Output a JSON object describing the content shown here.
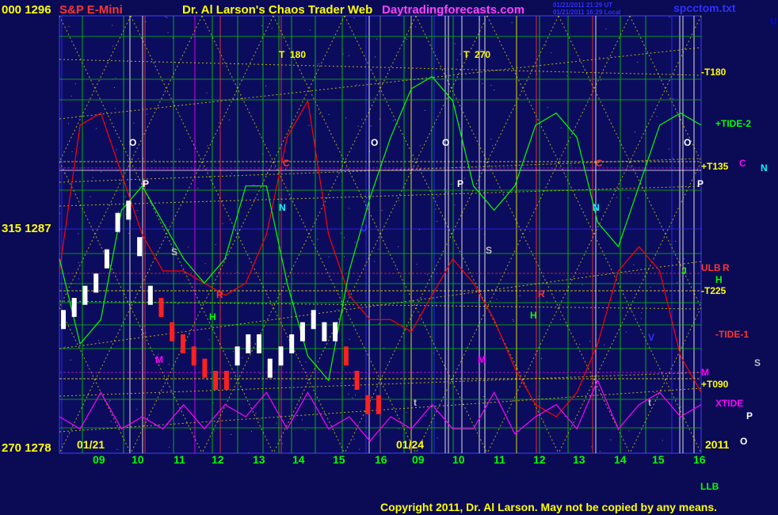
{
  "header": {
    "left_price": "000  1296",
    "instrument": "S&P E-Mini",
    "title": "Dr. Al Larson's Chaos Trader Web",
    "site": "Daytradingforecasts.com",
    "stamp1": "01/21/2011 21:29 UT",
    "stamp2": "01/21/2011 16:29 Local",
    "file": "spcctom.txt"
  },
  "price_labels": [
    {
      "label": "000  1296",
      "value": 1296
    },
    {
      "label": "315  1287",
      "value": 1287
    },
    {
      "label": "270  1278",
      "value": 1278
    }
  ],
  "chart_data": {
    "type": "line",
    "title": "S&P E-Mini",
    "ylim": [
      1278,
      1296
    ],
    "x_ticks": [
      "09",
      "10",
      "11",
      "12",
      "13",
      "14",
      "15",
      "16",
      "09",
      "10",
      "11",
      "12",
      "13",
      "14",
      "15",
      "16"
    ],
    "date_labels": [
      "01/21",
      "01/24",
      "2011"
    ],
    "top_markers": [
      "T  180",
      "T  270"
    ],
    "right_labels": [
      {
        "text": "-T180",
        "color": "#ffff00"
      },
      {
        "text": "+TIDE-2",
        "color": "#00ff00"
      },
      {
        "text": "+T135",
        "color": "#ffff00"
      },
      {
        "text": "C",
        "color": "#ff00ff"
      },
      {
        "text": "N",
        "color": "#00ffff"
      },
      {
        "text": "ULB",
        "color": "#ff3333"
      },
      {
        "text": "R",
        "color": "#ff3333"
      },
      {
        "text": "H",
        "color": "#00ff00"
      },
      {
        "text": "-T225",
        "color": "#ffff00"
      },
      {
        "text": "-TIDE-1",
        "color": "#ff3333"
      },
      {
        "text": "S",
        "color": "#c0c0c0"
      },
      {
        "text": "M",
        "color": "#ff00ff"
      },
      {
        "text": "+T090",
        "color": "#ffff00"
      },
      {
        "text": "XTIDE",
        "color": "#ff00ff"
      },
      {
        "text": "P",
        "color": "#ffffff"
      },
      {
        "text": "O",
        "color": "#ffffff"
      },
      {
        "text": "LLB",
        "color": "#00ff00"
      },
      {
        "text": "U",
        "color": "#0000ff"
      }
    ],
    "planet_markers": [
      "O",
      "P",
      "S",
      "M",
      "H",
      "R",
      "N",
      "C",
      "U",
      "V",
      "J",
      "t"
    ],
    "series": [
      {
        "color": "#ff0000",
        "values": [
          1285.5,
          1291.5,
          1292.0,
          1289.5,
          1287.0,
          1285.5,
          1285.5,
          1285.0,
          1284.5,
          1285.0,
          1287.0,
          1291.0,
          1292.5,
          1287.0,
          1284.5,
          1283.5,
          1283.5,
          1283.0,
          1284.5,
          1286.0,
          1285.0,
          1283.5,
          1281.5,
          1280.0,
          1279.5,
          1280.5,
          1282.5,
          1285.5,
          1286.5,
          1285.5,
          1282.0,
          1280.5
        ]
      },
      {
        "color": "#00ff00",
        "values": [
          1286.0,
          1282.5,
          1283.5,
          1288.0,
          1289.0,
          1287.5,
          1286.0,
          1285.0,
          1286.0,
          1289.0,
          1289.0,
          1285.0,
          1282.0,
          1281.0,
          1285.5,
          1288.5,
          1291.0,
          1293.0,
          1293.5,
          1292.5,
          1289.0,
          1288.0,
          1289.0,
          1291.5,
          1292.0,
          1291.0,
          1287.5,
          1286.5,
          1289.0,
          1291.5,
          1292.0,
          1291.5
        ]
      },
      {
        "color": "#ff00ff",
        "values": [
          1279.5,
          1279.0,
          1280.5,
          1279.0,
          1279.5,
          1279.0,
          1280.0,
          1279.0,
          1280.0,
          1279.5,
          1280.5,
          1279.0,
          1280.5,
          1279.0,
          1279.5,
          1278.5,
          1279.5,
          1279.0,
          1280.0,
          1279.0,
          1279.0,
          1280.5,
          1278.8,
          1279.5,
          1280.0,
          1279.0,
          1281.0,
          1279.0,
          1280.0,
          1280.5,
          1279.5,
          1280.0
        ]
      }
    ],
    "price_bars": [
      1283.5,
      1284.0,
      1284.5,
      1285.0,
      1286.0,
      1287.5,
      1288.0,
      1286.5,
      1284.5,
      1284.0,
      1283.0,
      1282.5,
      1282.0,
      1281.5,
      1281.0,
      1281.0,
      1282.0,
      1282.5,
      1282.5,
      1281.5,
      1282.0,
      1282.5,
      1283.0,
      1283.5,
      1283.0,
      1283.0,
      1282.0,
      1281.0,
      1280.0,
      1280.0
    ]
  },
  "footer": {
    "copyright": "Copyright 2011, Dr. Al Larson. May not be copied by any means."
  }
}
